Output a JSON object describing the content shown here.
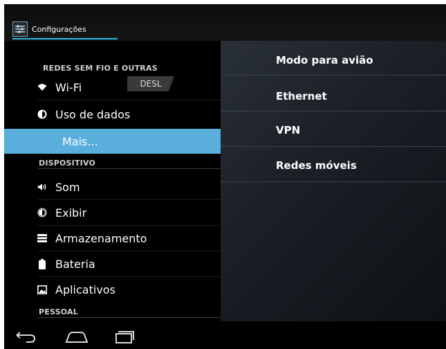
{
  "app": {
    "title": "Configurações",
    "icon": "settings-sliders-icon"
  },
  "left_pane": {
    "section_wireless": "REDES SEM FIO E OUTRAS",
    "wifi": {
      "label": "Wi-Fi",
      "toggle": "DESL",
      "icon": "wifi-icon"
    },
    "data_usage": {
      "label": "Uso de dados",
      "icon": "data-usage-icon"
    },
    "more": {
      "label": "Mais...",
      "selected": true
    },
    "section_device": "DISPOSITIVO",
    "device_items": [
      {
        "label": "Som",
        "icon": "speaker-icon"
      },
      {
        "label": "Exibir",
        "icon": "display-brightness-icon"
      },
      {
        "label": "Armazenamento",
        "icon": "storage-icon"
      },
      {
        "label": "Bateria",
        "icon": "battery-icon"
      },
      {
        "label": "Aplicativos",
        "icon": "apps-icon"
      }
    ],
    "section_personal": "PESSOAL"
  },
  "right_pane": {
    "items": [
      {
        "label": "Modo para avião"
      },
      {
        "label": "Ethernet"
      },
      {
        "label": "VPN"
      },
      {
        "label": "Redes móveis"
      }
    ]
  },
  "nav": {
    "back": "back-icon",
    "home": "home-icon",
    "recents": "recents-icon"
  },
  "colors": {
    "accent": "#33b5e5",
    "selected": "#5aaedc",
    "background": "#000000"
  }
}
